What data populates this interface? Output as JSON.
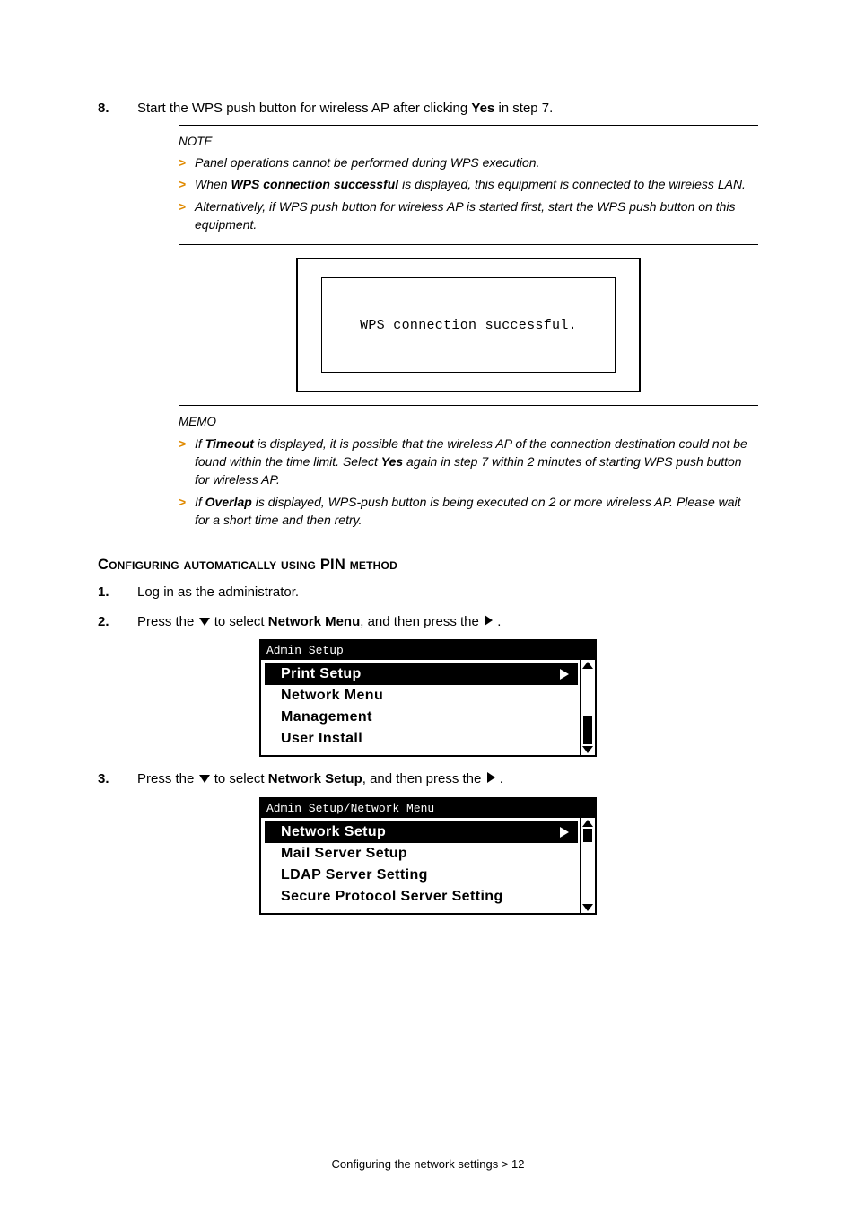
{
  "step8": {
    "num": "8.",
    "text_pre": "Start the WPS push button for wireless AP after clicking ",
    "bold": "Yes",
    "text_post": " in step 7."
  },
  "note": {
    "head": "NOTE",
    "b1": "Panel operations cannot be performed during WPS execution.",
    "b2_pre": "When ",
    "b2_bold": "WPS connection successful",
    "b2_post": " is displayed, this equipment is connected to the wireless LAN.",
    "b3": "Alternatively, if WPS push button for wireless AP is started first, start the WPS push button on this equipment."
  },
  "lcd": "WPS connection successful.",
  "memo": {
    "head": "MEMO",
    "b1_pre": "If ",
    "b1_bold1": "Timeout",
    "b1_mid1": " is displayed, it is possible that the wireless AP of the connection destination could not be found within the time limit. Select ",
    "b1_bold2": "Yes",
    "b1_post": " again in step 7 within 2 minutes of starting WPS push button for wireless AP.",
    "b2_pre": "If ",
    "b2_bold": "Overlap",
    "b2_post": " is displayed, WPS-push button is being executed on 2 or more wireless AP. Please wait for a short time and then retry."
  },
  "section": "Configuring automatically using PIN method",
  "step1": {
    "num": "1.",
    "text": "Log in as the administrator."
  },
  "step2": {
    "num": "2.",
    "pre": "Press the ",
    "mid": " to select ",
    "bold": "Network Menu",
    "post1": ", and then press the ",
    "post2": "."
  },
  "menu1": {
    "title": "Admin Setup",
    "i0": "Print Setup",
    "i1": "Network Menu",
    "i2": "Management",
    "i3": "User Install"
  },
  "step3": {
    "num": "3.",
    "pre": "Press the ",
    "mid": " to select ",
    "bold": "Network Setup",
    "post1": ", and then press the ",
    "post2": "."
  },
  "menu2": {
    "title": "Admin Setup/Network Menu",
    "i0": "Network Setup",
    "i1": "Mail Server Setup",
    "i2": "LDAP Server Setting",
    "i3": "Secure Protocol Server Setting"
  },
  "footer": "Configuring the network settings > 12"
}
